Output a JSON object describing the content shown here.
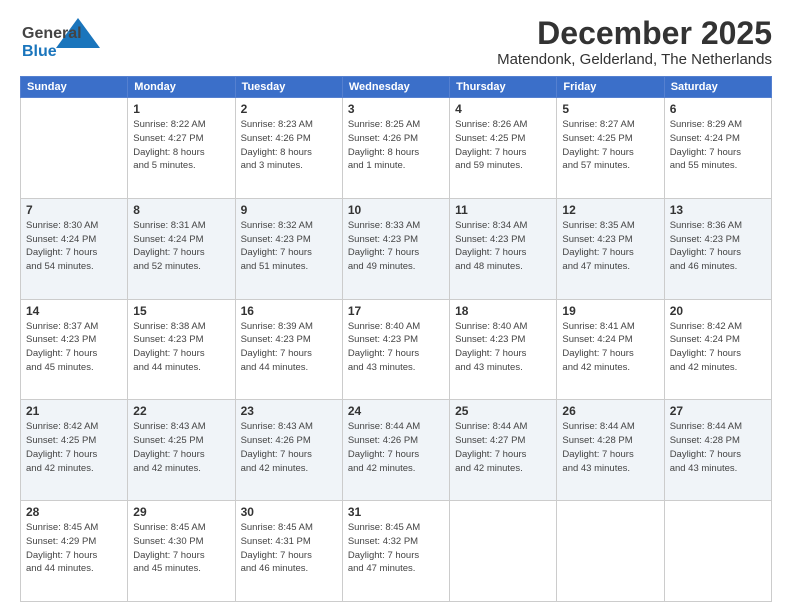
{
  "header": {
    "logo_general": "General",
    "logo_blue": "Blue",
    "month": "December 2025",
    "location": "Matendonk, Gelderland, The Netherlands"
  },
  "days_of_week": [
    "Sunday",
    "Monday",
    "Tuesday",
    "Wednesday",
    "Thursday",
    "Friday",
    "Saturday"
  ],
  "weeks": [
    {
      "shaded": false,
      "days": [
        {
          "num": "",
          "info": ""
        },
        {
          "num": "1",
          "info": "Sunrise: 8:22 AM\nSunset: 4:27 PM\nDaylight: 8 hours\nand 5 minutes."
        },
        {
          "num": "2",
          "info": "Sunrise: 8:23 AM\nSunset: 4:26 PM\nDaylight: 8 hours\nand 3 minutes."
        },
        {
          "num": "3",
          "info": "Sunrise: 8:25 AM\nSunset: 4:26 PM\nDaylight: 8 hours\nand 1 minute."
        },
        {
          "num": "4",
          "info": "Sunrise: 8:26 AM\nSunset: 4:25 PM\nDaylight: 7 hours\nand 59 minutes."
        },
        {
          "num": "5",
          "info": "Sunrise: 8:27 AM\nSunset: 4:25 PM\nDaylight: 7 hours\nand 57 minutes."
        },
        {
          "num": "6",
          "info": "Sunrise: 8:29 AM\nSunset: 4:24 PM\nDaylight: 7 hours\nand 55 minutes."
        }
      ]
    },
    {
      "shaded": true,
      "days": [
        {
          "num": "7",
          "info": "Sunrise: 8:30 AM\nSunset: 4:24 PM\nDaylight: 7 hours\nand 54 minutes."
        },
        {
          "num": "8",
          "info": "Sunrise: 8:31 AM\nSunset: 4:24 PM\nDaylight: 7 hours\nand 52 minutes."
        },
        {
          "num": "9",
          "info": "Sunrise: 8:32 AM\nSunset: 4:23 PM\nDaylight: 7 hours\nand 51 minutes."
        },
        {
          "num": "10",
          "info": "Sunrise: 8:33 AM\nSunset: 4:23 PM\nDaylight: 7 hours\nand 49 minutes."
        },
        {
          "num": "11",
          "info": "Sunrise: 8:34 AM\nSunset: 4:23 PM\nDaylight: 7 hours\nand 48 minutes."
        },
        {
          "num": "12",
          "info": "Sunrise: 8:35 AM\nSunset: 4:23 PM\nDaylight: 7 hours\nand 47 minutes."
        },
        {
          "num": "13",
          "info": "Sunrise: 8:36 AM\nSunset: 4:23 PM\nDaylight: 7 hours\nand 46 minutes."
        }
      ]
    },
    {
      "shaded": false,
      "days": [
        {
          "num": "14",
          "info": "Sunrise: 8:37 AM\nSunset: 4:23 PM\nDaylight: 7 hours\nand 45 minutes."
        },
        {
          "num": "15",
          "info": "Sunrise: 8:38 AM\nSunset: 4:23 PM\nDaylight: 7 hours\nand 44 minutes."
        },
        {
          "num": "16",
          "info": "Sunrise: 8:39 AM\nSunset: 4:23 PM\nDaylight: 7 hours\nand 44 minutes."
        },
        {
          "num": "17",
          "info": "Sunrise: 8:40 AM\nSunset: 4:23 PM\nDaylight: 7 hours\nand 43 minutes."
        },
        {
          "num": "18",
          "info": "Sunrise: 8:40 AM\nSunset: 4:23 PM\nDaylight: 7 hours\nand 43 minutes."
        },
        {
          "num": "19",
          "info": "Sunrise: 8:41 AM\nSunset: 4:24 PM\nDaylight: 7 hours\nand 42 minutes."
        },
        {
          "num": "20",
          "info": "Sunrise: 8:42 AM\nSunset: 4:24 PM\nDaylight: 7 hours\nand 42 minutes."
        }
      ]
    },
    {
      "shaded": true,
      "days": [
        {
          "num": "21",
          "info": "Sunrise: 8:42 AM\nSunset: 4:25 PM\nDaylight: 7 hours\nand 42 minutes."
        },
        {
          "num": "22",
          "info": "Sunrise: 8:43 AM\nSunset: 4:25 PM\nDaylight: 7 hours\nand 42 minutes."
        },
        {
          "num": "23",
          "info": "Sunrise: 8:43 AM\nSunset: 4:26 PM\nDaylight: 7 hours\nand 42 minutes."
        },
        {
          "num": "24",
          "info": "Sunrise: 8:44 AM\nSunset: 4:26 PM\nDaylight: 7 hours\nand 42 minutes."
        },
        {
          "num": "25",
          "info": "Sunrise: 8:44 AM\nSunset: 4:27 PM\nDaylight: 7 hours\nand 42 minutes."
        },
        {
          "num": "26",
          "info": "Sunrise: 8:44 AM\nSunset: 4:28 PM\nDaylight: 7 hours\nand 43 minutes."
        },
        {
          "num": "27",
          "info": "Sunrise: 8:44 AM\nSunset: 4:28 PM\nDaylight: 7 hours\nand 43 minutes."
        }
      ]
    },
    {
      "shaded": false,
      "days": [
        {
          "num": "28",
          "info": "Sunrise: 8:45 AM\nSunset: 4:29 PM\nDaylight: 7 hours\nand 44 minutes."
        },
        {
          "num": "29",
          "info": "Sunrise: 8:45 AM\nSunset: 4:30 PM\nDaylight: 7 hours\nand 45 minutes."
        },
        {
          "num": "30",
          "info": "Sunrise: 8:45 AM\nSunset: 4:31 PM\nDaylight: 7 hours\nand 46 minutes."
        },
        {
          "num": "31",
          "info": "Sunrise: 8:45 AM\nSunset: 4:32 PM\nDaylight: 7 hours\nand 47 minutes."
        },
        {
          "num": "",
          "info": ""
        },
        {
          "num": "",
          "info": ""
        },
        {
          "num": "",
          "info": ""
        }
      ]
    }
  ]
}
